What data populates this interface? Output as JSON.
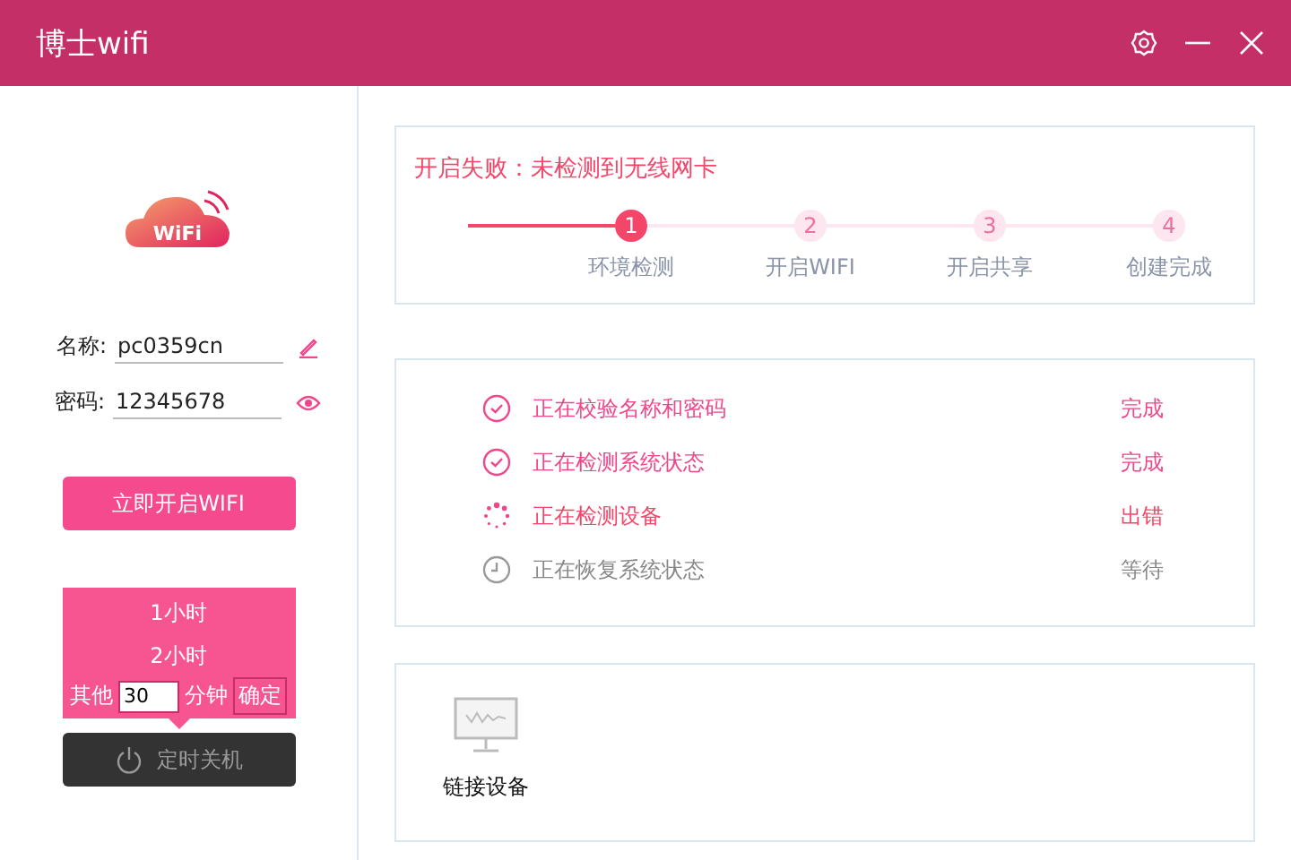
{
  "window": {
    "title": "博士wifi"
  },
  "logo_text": "WiFi",
  "form": {
    "name_label": "名称:",
    "name_value": "pc0359cn",
    "password_label": "密码:",
    "password_value": "12345678"
  },
  "start_button": "立即开启WIFI",
  "timer_menu": {
    "options": [
      "1小时",
      "2小时"
    ],
    "other_label": "其他",
    "minutes_value": "30",
    "unit": "分钟",
    "confirm": "确定"
  },
  "shutdown_button": "定时关机",
  "status_message": "开启失败：未检测到无线网卡",
  "steps": [
    {
      "number": "1",
      "label": "环境检测",
      "active": true
    },
    {
      "number": "2",
      "label": "开启WIFI",
      "active": false
    },
    {
      "number": "3",
      "label": "开启共享",
      "active": false
    },
    {
      "number": "4",
      "label": "创建完成",
      "active": false
    }
  ],
  "tasks": [
    {
      "kind": "done",
      "label": "正在校验名称和密码",
      "status": "完成"
    },
    {
      "kind": "done",
      "label": "正在检测系统状态",
      "status": "完成"
    },
    {
      "kind": "error",
      "label": "正在检测设备",
      "status": "出错"
    },
    {
      "kind": "waiting",
      "label": "正在恢复系统状态",
      "status": "等待"
    }
  ],
  "devices": {
    "label": "链接设备"
  }
}
